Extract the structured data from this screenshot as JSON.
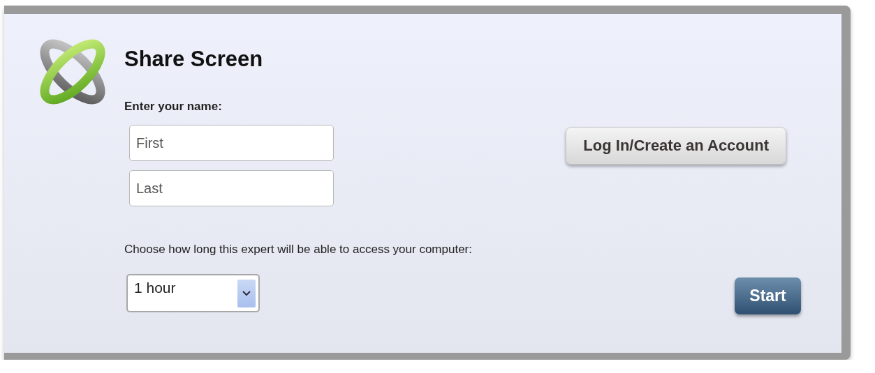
{
  "dialog": {
    "title": "Share Screen",
    "name_label": "Enter your name:",
    "name_fields": [
      {
        "placeholder": "First"
      },
      {
        "placeholder": "Last"
      }
    ],
    "login_button": "Log In/Create an Account",
    "duration_label": "Choose how long this expert will be able to access your computer:",
    "duration_select": {
      "value": "1 hour"
    },
    "start_button": "Start"
  }
}
